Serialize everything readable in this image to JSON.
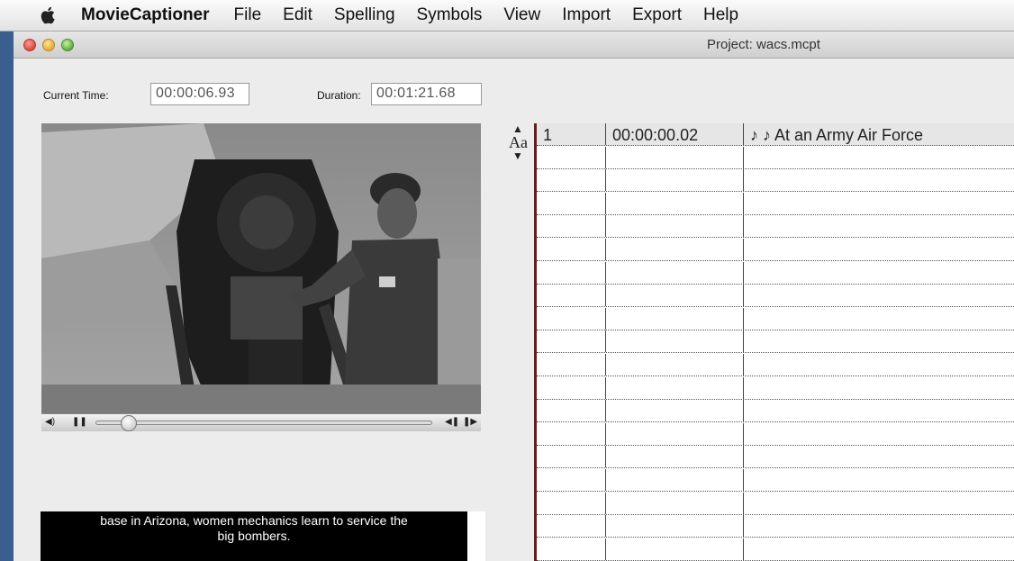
{
  "menubar": {
    "app_name": "MovieCaptioner",
    "items": [
      "File",
      "Edit",
      "Spelling",
      "Symbols",
      "View",
      "Import",
      "Export",
      "Help"
    ]
  },
  "window": {
    "title": "Project: wacs.mcpt"
  },
  "times": {
    "current_label": "Current Time:",
    "current_value": "00:00:06.93",
    "duration_label": "Duration:",
    "duration_value": "00:01:21.68"
  },
  "caption_preview": {
    "line1": "base in Arizona, women mechanics learn to service the",
    "line2": "big bombers."
  },
  "font_stepper": {
    "label": "Aa"
  },
  "table": {
    "rows": [
      {
        "num": "1",
        "time": "00:00:00.02",
        "text": "♪ ♪ At an Army Air Force"
      }
    ],
    "empty_rows": 18
  },
  "icons": {
    "apple": "apple-logo-icon",
    "volume": "volume-icon",
    "pause": "pause-icon",
    "step_back": "step-back-icon",
    "step_forward": "step-forward-icon"
  }
}
